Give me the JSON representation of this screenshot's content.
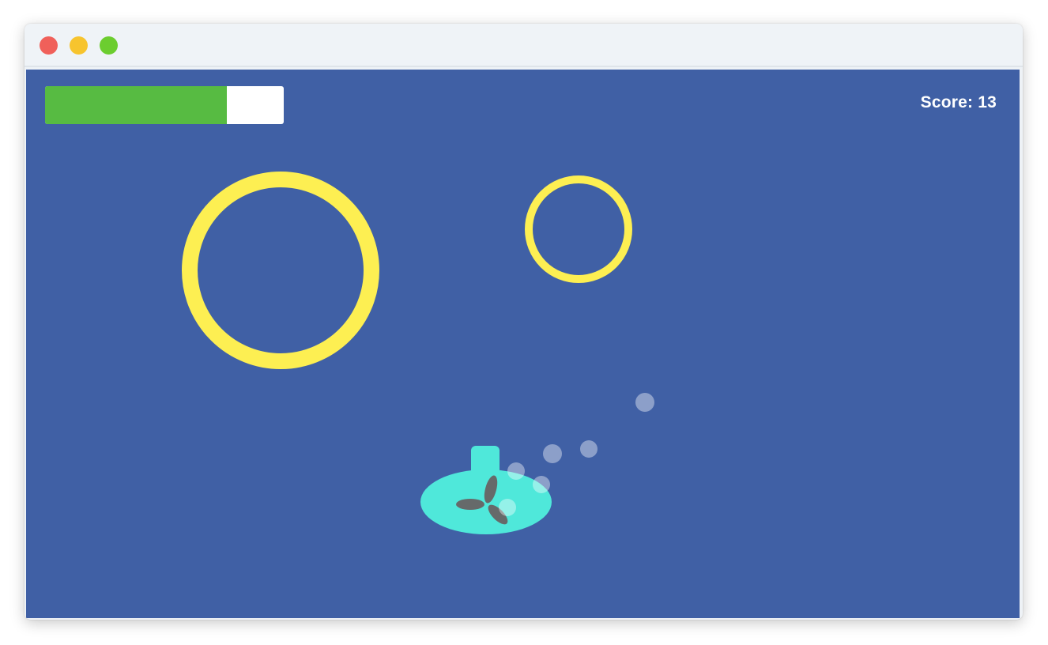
{
  "window": {
    "traffic_lights": [
      {
        "name": "close",
        "color": "#f0605a"
      },
      {
        "name": "minimize",
        "color": "#f7c42e"
      },
      {
        "name": "zoom",
        "color": "#6ccd2f"
      }
    ]
  },
  "game": {
    "background_color": "#4060a5",
    "health": {
      "fraction": 0.76,
      "fill_color": "#57bb42",
      "track_color": "#ffffff"
    },
    "score": {
      "label": "Score:",
      "value": "13"
    },
    "ring_color": "#fdef52",
    "submarine": {
      "hull_color": "#4fe8da",
      "propeller_color": "#666a6a"
    },
    "bubble_color": "rgba(255,255,255,0.4)"
  }
}
